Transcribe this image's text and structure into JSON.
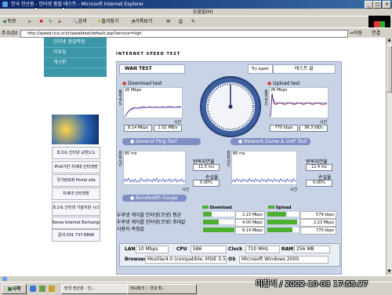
{
  "window": {
    "title": "한국 전산원 - 인터넷 품질 테스트 - Microsoft Internet Explorer",
    "watermark": "www.bcpark.net"
  },
  "menubar": {
    "help": "도움말(H)"
  },
  "toolbar": {
    "back": "뒤로",
    "search": "검색",
    "favorites": "즐겨찾기",
    "history": "기록보기"
  },
  "address": {
    "label": "주소(D)",
    "url": "http://speed.nca.or.kr/speedtest/default.asp?service=high",
    "go": "이동",
    "links": "연결"
  },
  "left_menu": {
    "items": [
      "인터넷 품질측정",
      "자료실",
      "게시판"
    ]
  },
  "ads": [
    "초고속 인터넷 교환노드",
    "IPv6기반 차세대 인터넷망",
    "국가정보화 Portal site",
    "차세대 인터넷망",
    "초고속 인터넷 기술지원 시스템",
    "Korea Internet Exchange",
    "문의 031 737-8898"
  ],
  "speedtest": {
    "header": "INTERNET SPEED TEST",
    "tab": "WAN TEST",
    "try_again": "Try again",
    "status": "테스트 끝",
    "download_test": {
      "title": "Download test",
      "axis_label": "동작속도",
      "time_label": "시간",
      "peak": "26 Mbps",
      "value1": "8.14 Mbps",
      "value2": "1.02 MB/s"
    },
    "upload_test": {
      "title": "Upload test",
      "axis_label": "동작속도",
      "time_label": "시간",
      "peak": "26 Mbps",
      "value1": "770 kbps",
      "value2": "96.3 kB/s"
    },
    "ping": {
      "title": "General Ping Test",
      "axis_label": "응답시간",
      "time_label": "시간",
      "scale": "80 ms",
      "avg_label": "왕복지연율",
      "avg_value": "11.5 ms",
      "loss_label": "손실율",
      "loss_value": "0.00%"
    },
    "netgame": {
      "title": "Network Game & VoIP Test",
      "axis_label": "응답시간",
      "time_label": "시간",
      "scale": "80 ms",
      "avg_label": "왕복지연율",
      "avg_value": "12.4 ms",
      "loss_label": "손실율",
      "loss_value": "0.00%"
    },
    "bandwidth": {
      "title": "Bandwidth Gauge",
      "download_header": "Download",
      "upload_header": "Upload",
      "rows": [
        {
          "label": "두루넷 케이블 인터넷(코넷) 평균",
          "down": "2.23 Mbps",
          "down_level": 0.27,
          "up": "579 kbps",
          "up_level": 0.6
        },
        {
          "label": "두루넷 케이블 인터넷(코넷) 최대값",
          "down": "4.00 Mbps",
          "down_level": 0.49,
          "up": "2.23 Mbps",
          "up_level": 0.95
        },
        {
          "label": "사용자 측정값",
          "down": "8.14 Mbps",
          "down_level": 1.0,
          "up": "770 kbps",
          "up_level": 0.8
        }
      ]
    },
    "sysinfo": {
      "lan_label": "LAN",
      "lan": "10 Mbps",
      "cpu_label": "CPU",
      "cpu": "586",
      "clock_label": "Clock",
      "clock": "710 MHz",
      "ram_label": "RAM",
      "ram": "256 MB",
      "browser_label": "Browser",
      "browser": "Mozilla/4.0 (compatible; MSIE 5.5",
      "os_label": "OS",
      "os": "Microsoft Windows 2000"
    }
  },
  "taskbar": {
    "start": "시작",
    "tasks": [
      "한국 전산원 - 인...",
      "비씨파크 :: 국내 최..."
    ]
  },
  "stamp": "미창식 / 2002-10-03 17:55:27"
}
